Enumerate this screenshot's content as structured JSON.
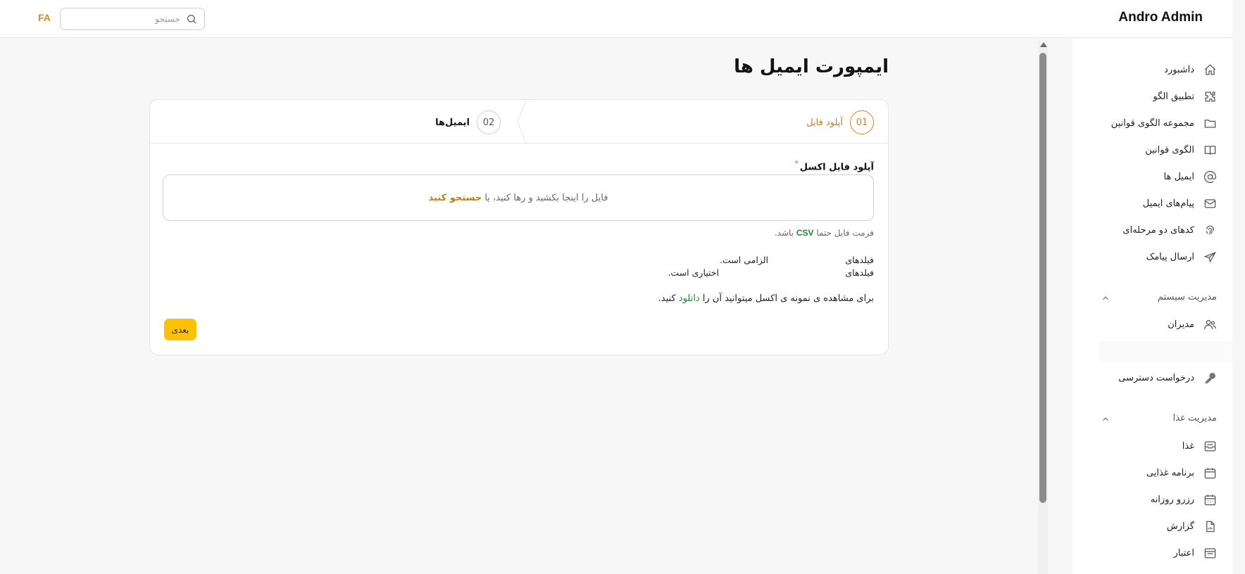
{
  "header": {
    "brand": "Andro Admin",
    "language": "FA",
    "search_placeholder": "جستجو"
  },
  "sidebar": {
    "items": [
      {
        "label": "داشبورد",
        "icon": "home-icon"
      },
      {
        "label": "تطبیق الگو",
        "icon": "puzzle-icon"
      },
      {
        "label": "مجموعه الگوی قوانین",
        "icon": "folder-icon"
      },
      {
        "label": "الگوی قوانین",
        "icon": "book-icon"
      },
      {
        "label": "ایمیل ها",
        "icon": "at-icon"
      },
      {
        "label": "پیام‌های ایمیل",
        "icon": "mail-icon"
      },
      {
        "label": "کدهای دو مرحله‌ای",
        "icon": "fingerprint-icon"
      },
      {
        "label": "ارسال پیامک",
        "icon": "send-icon"
      }
    ],
    "system_section": {
      "title": "مدیریت سیستم",
      "items": [
        {
          "label": "مدیران",
          "icon": "users-icon"
        },
        {
          "label": "درخواست دسترسی",
          "icon": "key-icon"
        }
      ]
    },
    "food_section": {
      "title": "مدیریت غذا",
      "items": [
        {
          "label": "غذا",
          "icon": "inbox-icon"
        },
        {
          "label": "برنامه غذایی",
          "icon": "calendar-icon"
        },
        {
          "label": "رزرو روزانه",
          "icon": "calendar-grid-icon"
        },
        {
          "label": "گزارش",
          "icon": "report-icon"
        },
        {
          "label": "اعتبار",
          "icon": "wallet-icon"
        }
      ]
    }
  },
  "main": {
    "page_title": "ایمپورت ایمیل ها",
    "steps": [
      {
        "number": "01",
        "label": "آپلود فایل",
        "state": "active"
      },
      {
        "number": "02",
        "label": "ایمیل‌ها",
        "state": "inactive"
      }
    ],
    "upload": {
      "label": "آپلود فایل اکسل",
      "required_mark": "*",
      "drop_text": "فایل را اینجا بکشید و رها کنید، یا ",
      "browse_text": "جستجو کنید",
      "format_prefix": "فرمت فایل حتما ",
      "format_value": "CSV",
      "format_suffix": " باشد."
    },
    "fields": [
      {
        "key": "فیلدهای",
        "value": "الزامی است."
      },
      {
        "key": "فیلدهای",
        "value": "اختیاری است."
      }
    ],
    "sample": {
      "prefix": "برای مشاهده ی نمونه ی اکسل میتوانید آن را ",
      "link": "دانلود",
      "suffix": " کنید."
    },
    "next_button": "بعدی"
  },
  "colors": {
    "accent": "#d4861e",
    "button": "#ffc107",
    "success": "#1f8a2f"
  }
}
